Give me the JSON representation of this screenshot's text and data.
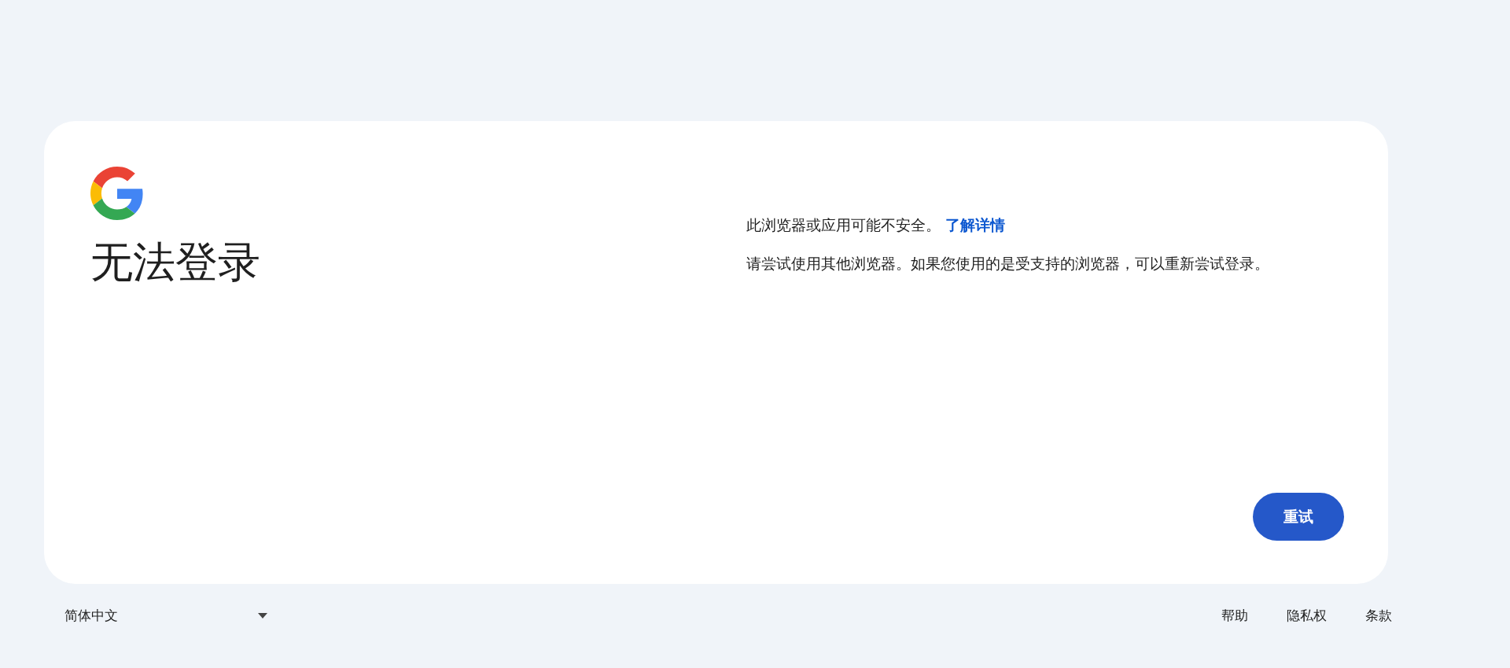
{
  "card": {
    "title": "无法登录",
    "message": {
      "text": "此浏览器或应用可能不安全。",
      "link": "了解详情"
    },
    "detail": "请尝试使用其他浏览器。如果您使用的是受支持的浏览器，可以重新尝试登录。",
    "button": "重试"
  },
  "footer": {
    "language": "简体中文",
    "links": [
      "帮助",
      "隐私权",
      "条款"
    ]
  }
}
